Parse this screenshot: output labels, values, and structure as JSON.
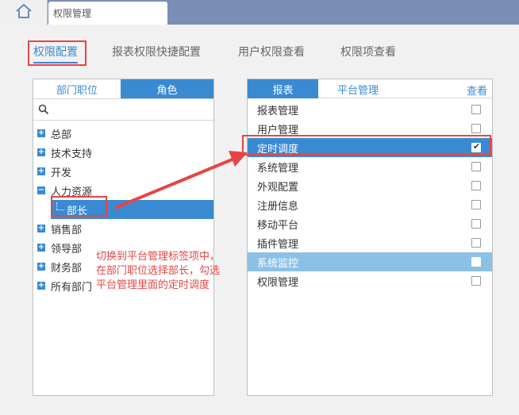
{
  "topbar": {
    "home_icon": "home-icon",
    "tab_title": "权限管理"
  },
  "subnav": {
    "items": [
      "权限配置",
      "报表权限快捷配置",
      "用户权限查看",
      "权限项查看"
    ],
    "active_index": 0
  },
  "left_panel": {
    "tabs": [
      "部门职位",
      "角色"
    ],
    "search_icon": "search-icon",
    "tree": [
      {
        "label": "总部",
        "expander": "+"
      },
      {
        "label": "技术支持",
        "expander": "+"
      },
      {
        "label": "开发",
        "expander": "+"
      },
      {
        "label": "人力资源",
        "expander": "−"
      },
      {
        "label": "部长",
        "child": true,
        "selected": true
      },
      {
        "label": "销售部",
        "expander": "+"
      },
      {
        "label": "领导部",
        "expander": "+"
      },
      {
        "label": "财务部",
        "expander": "+"
      },
      {
        "label": "所有部门",
        "expander": "+"
      }
    ]
  },
  "right_panel": {
    "tabs": [
      "报表",
      "平台管理"
    ],
    "column_header": "查看",
    "items": [
      {
        "label": "报表管理",
        "checked": false
      },
      {
        "label": "用户管理",
        "checked": false
      },
      {
        "label": "定时调度",
        "checked": true,
        "selected": true
      },
      {
        "label": "系统管理",
        "checked": false
      },
      {
        "label": "外观配置",
        "checked": false
      },
      {
        "label": "注册信息",
        "checked": false
      },
      {
        "label": "移动平台",
        "checked": false
      },
      {
        "label": "插件管理",
        "checked": false
      },
      {
        "label": "系统监控",
        "checked": false,
        "hover": true
      },
      {
        "label": "权限管理",
        "checked": false
      }
    ]
  },
  "annotation": {
    "lines": [
      "切换到平台管理标签项中，",
      "在部门职位选择部长，勾选",
      "平台管理里面的定时调度"
    ]
  },
  "colors": {
    "accent": "#3a8ad2",
    "annotation": "#e64545",
    "topbar": "#7a8fb6"
  }
}
